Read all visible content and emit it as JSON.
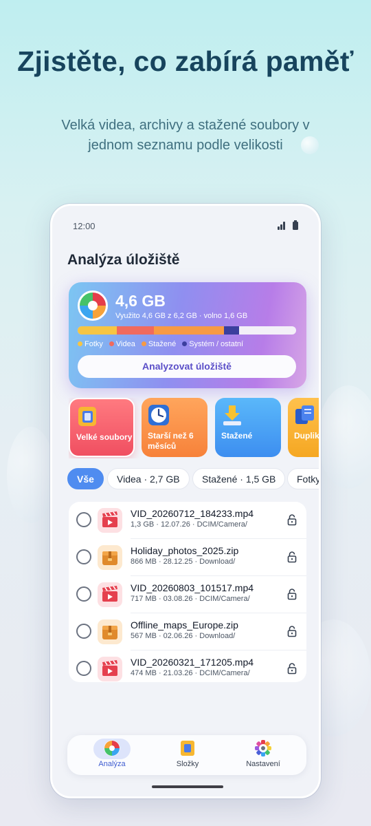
{
  "promo": {
    "headline": "Zjistěte, co zabírá paměť",
    "subline": "Velká videa, archivy a stažené soubory v jednom seznamu podle velikosti"
  },
  "status_bar": {
    "time": "12:00"
  },
  "app": {
    "title": "Analýza úložiště"
  },
  "storage": {
    "used_value": "4,6 GB",
    "usage_text": "Využito 4,6 GB z 6,2 GB · volno 1,6 GB",
    "segments": [
      {
        "label": "Fotky",
        "color": "#f6c544",
        "fraction": 0.18
      },
      {
        "label": "Videa",
        "color": "#f06a5e",
        "fraction": 0.17
      },
      {
        "label": "Stažené",
        "color": "#f79a45",
        "fraction": 0.32
      },
      {
        "label": "Systém / ostatní",
        "color": "#3b3f9e",
        "fraction": 0.07
      }
    ],
    "free_color": "#f3f0f8",
    "analyze_button": "Analyzovat úložiště"
  },
  "categories": [
    {
      "label": "Velké soubory",
      "icon": "file-icon"
    },
    {
      "label": "Starší než 6 měsíců",
      "icon": "clock-icon"
    },
    {
      "label": "Stažené",
      "icon": "download-icon"
    },
    {
      "label": "Duplikáty",
      "icon": "duplicate-icon"
    }
  ],
  "filters": [
    {
      "label": "Vše",
      "active": true
    },
    {
      "label": "Videa · 2,7 GB",
      "active": false
    },
    {
      "label": "Stažené · 1,5 GB",
      "active": false
    },
    {
      "label": "Fotky",
      "active": false
    }
  ],
  "files": [
    {
      "name": "VID_20260712_184233.mp4",
      "meta": "1,3 GB · 12.07.26 · DCIM/Camera/",
      "type": "video"
    },
    {
      "name": "Holiday_photos_2025.zip",
      "meta": "866 MB · 28.12.25 · Download/",
      "type": "archive"
    },
    {
      "name": "VID_20260803_101517.mp4",
      "meta": "717 MB · 03.08.26 · DCIM/Camera/",
      "type": "video"
    },
    {
      "name": "Offline_maps_Europe.zip",
      "meta": "567 MB · 02.06.26 · Download/",
      "type": "archive"
    },
    {
      "name": "VID_20260321_171205.mp4",
      "meta": "474 MB · 21.03.26 · DCIM/Camera/",
      "type": "video"
    }
  ],
  "nav": [
    {
      "label": "Analýza",
      "icon": "pie-chart-icon",
      "active": true
    },
    {
      "label": "Složky",
      "icon": "folder-icon",
      "active": false
    },
    {
      "label": "Nastavení",
      "icon": "settings-icon",
      "active": false
    }
  ]
}
